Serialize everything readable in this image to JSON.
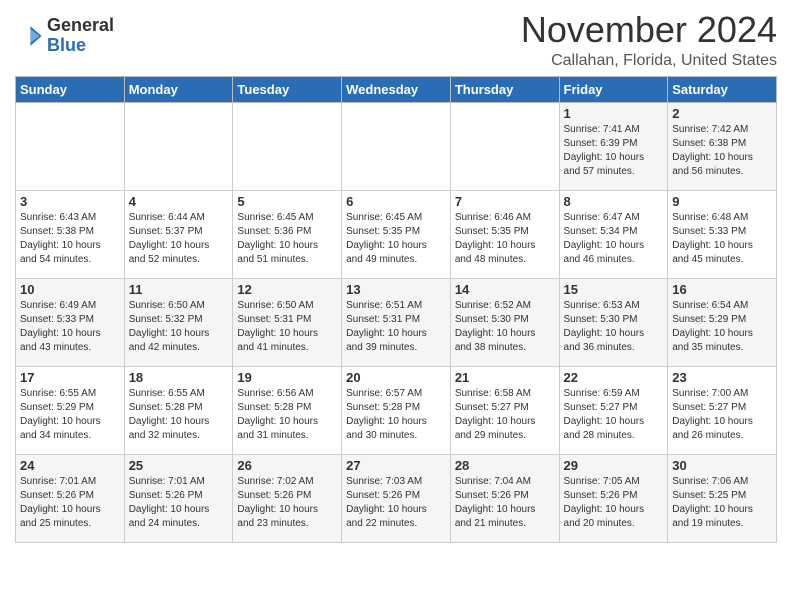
{
  "header": {
    "logo_general": "General",
    "logo_blue": "Blue",
    "month": "November 2024",
    "location": "Callahan, Florida, United States"
  },
  "weekdays": [
    "Sunday",
    "Monday",
    "Tuesday",
    "Wednesday",
    "Thursday",
    "Friday",
    "Saturday"
  ],
  "weeks": [
    [
      {
        "day": "",
        "content": ""
      },
      {
        "day": "",
        "content": ""
      },
      {
        "day": "",
        "content": ""
      },
      {
        "day": "",
        "content": ""
      },
      {
        "day": "",
        "content": ""
      },
      {
        "day": "1",
        "content": "Sunrise: 7:41 AM\nSunset: 6:39 PM\nDaylight: 10 hours and 57 minutes."
      },
      {
        "day": "2",
        "content": "Sunrise: 7:42 AM\nSunset: 6:38 PM\nDaylight: 10 hours and 56 minutes."
      }
    ],
    [
      {
        "day": "3",
        "content": "Sunrise: 6:43 AM\nSunset: 5:38 PM\nDaylight: 10 hours and 54 minutes."
      },
      {
        "day": "4",
        "content": "Sunrise: 6:44 AM\nSunset: 5:37 PM\nDaylight: 10 hours and 52 minutes."
      },
      {
        "day": "5",
        "content": "Sunrise: 6:45 AM\nSunset: 5:36 PM\nDaylight: 10 hours and 51 minutes."
      },
      {
        "day": "6",
        "content": "Sunrise: 6:45 AM\nSunset: 5:35 PM\nDaylight: 10 hours and 49 minutes."
      },
      {
        "day": "7",
        "content": "Sunrise: 6:46 AM\nSunset: 5:35 PM\nDaylight: 10 hours and 48 minutes."
      },
      {
        "day": "8",
        "content": "Sunrise: 6:47 AM\nSunset: 5:34 PM\nDaylight: 10 hours and 46 minutes."
      },
      {
        "day": "9",
        "content": "Sunrise: 6:48 AM\nSunset: 5:33 PM\nDaylight: 10 hours and 45 minutes."
      }
    ],
    [
      {
        "day": "10",
        "content": "Sunrise: 6:49 AM\nSunset: 5:33 PM\nDaylight: 10 hours and 43 minutes."
      },
      {
        "day": "11",
        "content": "Sunrise: 6:50 AM\nSunset: 5:32 PM\nDaylight: 10 hours and 42 minutes."
      },
      {
        "day": "12",
        "content": "Sunrise: 6:50 AM\nSunset: 5:31 PM\nDaylight: 10 hours and 41 minutes."
      },
      {
        "day": "13",
        "content": "Sunrise: 6:51 AM\nSunset: 5:31 PM\nDaylight: 10 hours and 39 minutes."
      },
      {
        "day": "14",
        "content": "Sunrise: 6:52 AM\nSunset: 5:30 PM\nDaylight: 10 hours and 38 minutes."
      },
      {
        "day": "15",
        "content": "Sunrise: 6:53 AM\nSunset: 5:30 PM\nDaylight: 10 hours and 36 minutes."
      },
      {
        "day": "16",
        "content": "Sunrise: 6:54 AM\nSunset: 5:29 PM\nDaylight: 10 hours and 35 minutes."
      }
    ],
    [
      {
        "day": "17",
        "content": "Sunrise: 6:55 AM\nSunset: 5:29 PM\nDaylight: 10 hours and 34 minutes."
      },
      {
        "day": "18",
        "content": "Sunrise: 6:55 AM\nSunset: 5:28 PM\nDaylight: 10 hours and 32 minutes."
      },
      {
        "day": "19",
        "content": "Sunrise: 6:56 AM\nSunset: 5:28 PM\nDaylight: 10 hours and 31 minutes."
      },
      {
        "day": "20",
        "content": "Sunrise: 6:57 AM\nSunset: 5:28 PM\nDaylight: 10 hours and 30 minutes."
      },
      {
        "day": "21",
        "content": "Sunrise: 6:58 AM\nSunset: 5:27 PM\nDaylight: 10 hours and 29 minutes."
      },
      {
        "day": "22",
        "content": "Sunrise: 6:59 AM\nSunset: 5:27 PM\nDaylight: 10 hours and 28 minutes."
      },
      {
        "day": "23",
        "content": "Sunrise: 7:00 AM\nSunset: 5:27 PM\nDaylight: 10 hours and 26 minutes."
      }
    ],
    [
      {
        "day": "24",
        "content": "Sunrise: 7:01 AM\nSunset: 5:26 PM\nDaylight: 10 hours and 25 minutes."
      },
      {
        "day": "25",
        "content": "Sunrise: 7:01 AM\nSunset: 5:26 PM\nDaylight: 10 hours and 24 minutes."
      },
      {
        "day": "26",
        "content": "Sunrise: 7:02 AM\nSunset: 5:26 PM\nDaylight: 10 hours and 23 minutes."
      },
      {
        "day": "27",
        "content": "Sunrise: 7:03 AM\nSunset: 5:26 PM\nDaylight: 10 hours and 22 minutes."
      },
      {
        "day": "28",
        "content": "Sunrise: 7:04 AM\nSunset: 5:26 PM\nDaylight: 10 hours and 21 minutes."
      },
      {
        "day": "29",
        "content": "Sunrise: 7:05 AM\nSunset: 5:26 PM\nDaylight: 10 hours and 20 minutes."
      },
      {
        "day": "30",
        "content": "Sunrise: 7:06 AM\nSunset: 5:25 PM\nDaylight: 10 hours and 19 minutes."
      }
    ]
  ]
}
